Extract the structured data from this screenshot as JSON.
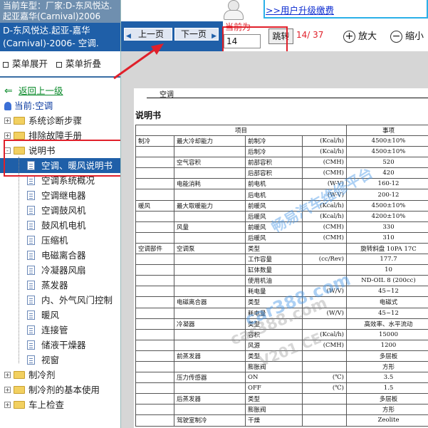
{
  "sidebar": {
    "vehicle_banner": "当前车型：厂家:D-东风悦达.起亚嘉华(Carnival)2006",
    "vehicle_title_line1": "D-东风悦达.起亚-嘉华",
    "vehicle_title_line2": "(Carnival)-2006- 空调.",
    "expand_all": "菜单展开",
    "collapse_all": "菜单折叠",
    "back_link": "返回上一级",
    "current_label": "当前:空调",
    "tree": [
      {
        "label": "系统诊断步骤",
        "toggle": "+"
      },
      {
        "label": "排除故障手册",
        "toggle": "+"
      },
      {
        "label": "说明书",
        "toggle": "-"
      }
    ],
    "leaves": [
      "空调、暖风说明书",
      "空调系统概况",
      "空调继电器",
      "空调鼓风机",
      "鼓风机电机",
      "压缩机",
      "电磁离合器",
      "冷凝器风扇",
      "蒸发器",
      "内、外气风门控制",
      "暖风",
      "连接管",
      "储液干燥器",
      "视窗"
    ],
    "tree_bottom": [
      {
        "label": "制冷剂",
        "toggle": "+"
      },
      {
        "label": "制冷剂的基本使用",
        "toggle": "+"
      },
      {
        "label": "车上检查",
        "toggle": "+"
      }
    ]
  },
  "topbar": {
    "upgrade_link": ">>用户升级缴费"
  },
  "toolbar": {
    "prev_page": "上一页",
    "next_page": "下一页",
    "current_label": "当前为",
    "page_value": "14",
    "jump_label": "跳转",
    "page_count": "14/ 37",
    "zoom_in": "放大",
    "zoom_out": "缩小"
  },
  "document": {
    "section": "空调",
    "title": "说明书",
    "header_item": "项目",
    "header_value": "事项",
    "rows": [
      [
        "制冷",
        "最大冷却能力",
        "前制冷",
        "(Kcal/h)",
        "4500±10%"
      ],
      [
        "",
        "",
        "后制冷",
        "(Kcal/h)",
        "4500±10%"
      ],
      [
        "",
        "空气容积",
        "前部容积",
        "(CMH)",
        "520"
      ],
      [
        "",
        "",
        "后部容积",
        "(CMH)",
        "420"
      ],
      [
        "",
        "电能消耗",
        "前电机",
        "(W-V)",
        "160-12"
      ],
      [
        "",
        "",
        "后电机",
        "(W-V)",
        "200-12"
      ],
      [
        "暖风",
        "最大取暖能力",
        "前暖风",
        "(Kcal/h)",
        "4500±10%"
      ],
      [
        "",
        "",
        "后暖风",
        "(Kcal/h)",
        "4200±10%"
      ],
      [
        "",
        "风量",
        "前暖风",
        "(CMH)",
        "330"
      ],
      [
        "",
        "",
        "后暖风",
        "(CMH)",
        "310"
      ],
      [
        "空调部件",
        "空调泵",
        "类型",
        "",
        "旋转斜盘 10PA 17C"
      ],
      [
        "",
        "",
        "工作容量",
        "(cc/Rev)",
        "177.7"
      ],
      [
        "",
        "",
        "缸体数量",
        "",
        "10"
      ],
      [
        "",
        "",
        "使用机油",
        "",
        "ND-OIL 8 (200cc)"
      ],
      [
        "",
        "",
        "耗电量",
        "(W/V)",
        "45~12"
      ],
      [
        "",
        "电磁离合器",
        "类型",
        "",
        "电磁式"
      ],
      [
        "",
        "",
        "耗电量",
        "(W/V)",
        "45~12"
      ],
      [
        "",
        "冷凝器",
        "类型",
        "",
        "高效率、水平流动"
      ],
      [
        "",
        "",
        "容积",
        "(Kcal/h)",
        "15000"
      ],
      [
        "",
        "",
        "风源",
        "(CMH)",
        "1200"
      ],
      [
        "",
        "前蒸发器",
        "类型",
        "",
        "多层板"
      ],
      [
        "",
        "",
        "膨胀阀",
        "",
        "方形"
      ],
      [
        "",
        "压力传感器",
        "ON",
        "(℃)",
        "3.5"
      ],
      [
        "",
        "",
        "OFF",
        "(℃)",
        "1.5"
      ],
      [
        "",
        "后蒸发器",
        "类型",
        "",
        "多层板"
      ],
      [
        "",
        "",
        "膨胀阀",
        "",
        "方形"
      ],
      [
        "",
        "驾驶室制冷",
        "干燥",
        "",
        "Zeolite"
      ]
    ]
  },
  "watermarks": {
    "brand": "畅易汽车维修平台",
    "site": "car388.com",
    "site_faint": "car388.com",
    "code": "V201 CE"
  },
  "colors": {
    "accent_blue": "#1f5fa8",
    "highlight_red": "#e0202a",
    "link_green": "#0a8a2a"
  }
}
